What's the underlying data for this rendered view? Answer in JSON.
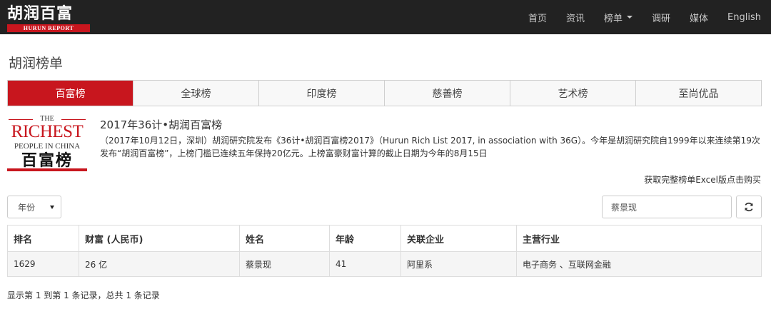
{
  "header": {
    "logo_cn": "胡润百富",
    "logo_en": "HURUN REPORT",
    "nav": [
      {
        "label": "首页"
      },
      {
        "label": "资讯"
      },
      {
        "label": "榜单"
      },
      {
        "label": "调研"
      },
      {
        "label": "媒体"
      },
      {
        "label": "English"
      }
    ]
  },
  "page_title": "胡润榜单",
  "tabs": [
    {
      "label": "百富榜",
      "active": true
    },
    {
      "label": "全球榜"
    },
    {
      "label": "印度榜"
    },
    {
      "label": "慈善榜"
    },
    {
      "label": "艺术榜"
    },
    {
      "label": "至尚优品"
    }
  ],
  "intro": {
    "logo_the": "THE",
    "logo_richest": "RICHEST",
    "logo_people": "PEOPLE IN CHINA",
    "logo_cn": "百富榜",
    "title": "2017年36计•胡润百富榜",
    "text": "（2017年10月12日，深圳）胡润研究院发布《36计•胡润百富榜2017》（Hurun Rich List 2017, in association with 36G）。今年是胡润研究院自1999年以来连续第19次发布“胡润百富榜”，上榜门槛已连续五年保持20亿元。上榜富豪财富计算的截止日期为今年的8月15日"
  },
  "buy_link": "获取完整榜单Excel版点击购买",
  "filters": {
    "year_label": "年份",
    "search_value": "蔡景现"
  },
  "table": {
    "headers": [
      "排名",
      "财富 (人民币)",
      "姓名",
      "年龄",
      "关联企业",
      "主营行业"
    ],
    "rows": [
      [
        "1629",
        "26 亿",
        "蔡景现",
        "41",
        "阿里系",
        "电子商务 、互联网金融"
      ]
    ]
  },
  "pagination_info": "显示第 1 到第 1 条记录，总共 1 条记录",
  "colors": {
    "navbar": "#222222",
    "brand_red": "#c8161e"
  }
}
